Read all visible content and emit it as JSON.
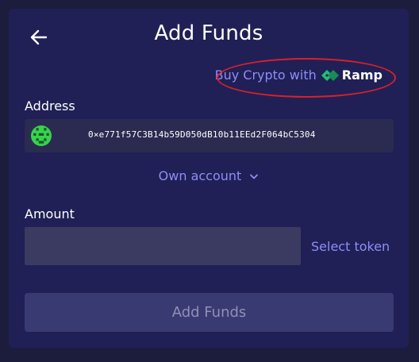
{
  "header": {
    "title": "Add Funds",
    "back_icon": "arrow-left-icon"
  },
  "ramp": {
    "prefix": "Buy Crypto with",
    "brand": "Ramp",
    "logo_icon": "ramp-logo-icon"
  },
  "address": {
    "label": "Address",
    "value": "0×e771f57C3B14b59D050dB10b11EEd2F064bC5304",
    "avatar_icon": "identicon-avatar"
  },
  "account_select": {
    "label": "Own account",
    "icon": "chevron-down-icon"
  },
  "amount": {
    "label": "Amount",
    "value": "",
    "placeholder": ""
  },
  "token": {
    "label": "Select token"
  },
  "submit": {
    "label": "Add Funds"
  },
  "colors": {
    "background": "#1c1c3d",
    "panel": "#202056",
    "accent": "#8d8df7",
    "ramp_green": "#21bf73",
    "highlight": "#d9202a"
  }
}
